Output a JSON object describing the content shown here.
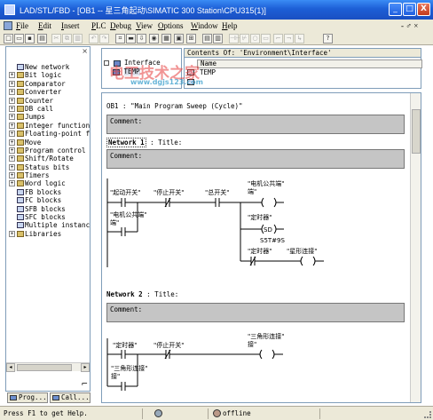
{
  "window": {
    "title": "LAD/STL/FBD  - [OB1 -- 星三角起动\\SIMATIC 300 Station\\CPU315(1)]",
    "min_label": "_",
    "max_label": "□",
    "close_label": "X"
  },
  "menubar": {
    "items": [
      "File",
      "Edit",
      "Insert",
      "PLC",
      "Debug",
      "View",
      "Options",
      "Window",
      "Help"
    ],
    "right_controls": "- ♂ ×"
  },
  "toolbar": {
    "buttons": [
      "new",
      "open",
      "save",
      "print",
      "cut",
      "copy",
      "paste",
      "undo",
      "redo",
      "online",
      "offline",
      "download",
      "monitor",
      "overview",
      "details",
      "zoom",
      "insert-network",
      "contact-no",
      "contact-nc",
      "coil",
      "box",
      "branch-open",
      "branch-close",
      "help"
    ]
  },
  "left_pane": {
    "close_label": "×",
    "tree": [
      {
        "label": "New network",
        "expandable": false,
        "icon": "new-network-icon"
      },
      {
        "label": "Bit logic",
        "expandable": true,
        "icon": "folder-icon"
      },
      {
        "label": "Comparator",
        "expandable": true,
        "icon": "folder-icon"
      },
      {
        "label": "Converter",
        "expandable": true,
        "icon": "folder-icon"
      },
      {
        "label": "Counter",
        "expandable": true,
        "icon": "folder-icon"
      },
      {
        "label": "DB call",
        "expandable": true,
        "icon": "folder-icon"
      },
      {
        "label": "Jumps",
        "expandable": true,
        "icon": "folder-icon"
      },
      {
        "label": "Integer function",
        "expandable": true,
        "icon": "folder-icon"
      },
      {
        "label": "Floating-point fc",
        "expandable": true,
        "icon": "folder-icon"
      },
      {
        "label": "Move",
        "expandable": true,
        "icon": "folder-icon"
      },
      {
        "label": "Program control",
        "expandable": true,
        "icon": "folder-icon"
      },
      {
        "label": "Shift/Rotate",
        "expandable": true,
        "icon": "folder-icon"
      },
      {
        "label": "Status bits",
        "expandable": true,
        "icon": "folder-icon"
      },
      {
        "label": "Timers",
        "expandable": true,
        "icon": "folder-icon"
      },
      {
        "label": "Word logic",
        "expandable": true,
        "icon": "folder-icon"
      },
      {
        "label": "FB blocks",
        "expandable": false,
        "icon": "block-icon"
      },
      {
        "label": "FC blocks",
        "expandable": false,
        "icon": "block-icon"
      },
      {
        "label": "SFB blocks",
        "expandable": false,
        "icon": "block-icon"
      },
      {
        "label": "SFC blocks",
        "expandable": false,
        "icon": "block-icon"
      },
      {
        "label": "Multiple instance",
        "expandable": false,
        "icon": "block-icon"
      },
      {
        "label": "Libraries",
        "expandable": true,
        "icon": "folder-icon"
      }
    ],
    "tabs": [
      "Prog...",
      "Call..."
    ]
  },
  "interface_pane": {
    "items": [
      "Interface",
      "TEMP"
    ]
  },
  "contents": {
    "header": "Contents Of: 'Environment\\Interface'",
    "column": "Name",
    "rows": [
      "TEMP"
    ]
  },
  "editor": {
    "ob_title": "OB1 :  \"Main Program Sweep (Cycle)\"",
    "comment_label": "Comment:",
    "networks": [
      {
        "number": "Network 1",
        "title": ": Title:",
        "comment": "Comment:",
        "contacts": [
          "\"起动开关\"",
          "\"停止开关\"",
          "\"总开关\"",
          "\"电机公共端\""
        ],
        "coils": [
          "\"电机公共端\"",
          "\"定时器\"",
          "\"星形连接\""
        ],
        "timer_preset": "S5T#9S",
        "timer_instr": "SD",
        "timer_contact": "\"定时器\""
      },
      {
        "number": "Network 2",
        "title": ": Title:",
        "comment": "Comment:",
        "contacts": [
          "\"定时器\"",
          "\"停止开关\"",
          "\"三角形连接\""
        ],
        "coils": [
          "\"三角形连接\""
        ]
      }
    ]
  },
  "watermark": {
    "line1": "电工技术之家",
    "line2": "www.dgjs123.com"
  },
  "statusbar": {
    "hint": "Press F1 to get Help.",
    "mode": "offline"
  },
  "colors": {
    "titlebar": "#1d5fd6",
    "chrome": "#ece9d8",
    "comment_box": "#c5c5c5",
    "close_button": "#c43a1c"
  }
}
